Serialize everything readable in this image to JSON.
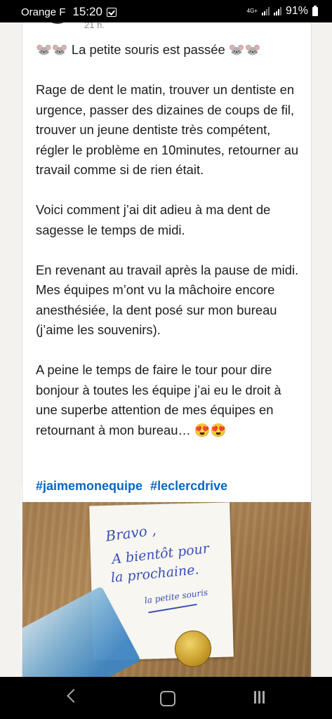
{
  "status_bar": {
    "carrier": "Orange F",
    "time": "15:20",
    "network": "4G+",
    "battery": "91%"
  },
  "post": {
    "time_ago": "21 h.",
    "paragraphs": [
      "🐭🐭  La petite souris est passée 🐭🐭",
      "Rage de dent le matin, trouver un dentiste en urgence, passer des dizaines de coups de fil, trouver un jeune dentiste très compétent, régler le problème en 10minutes, retourner au travail comme si de rien était.",
      "Voici comment j’ai dit adieu à ma dent de sagesse le temps de midi.",
      "En revenant au travail après la pause de midi. Mes équipes m’ont vu la mâchoire encore anesthésiée, la dent posé sur mon bureau (j’aime les souvenirs).",
      "A peine le temps de faire le tour pour dire bonjour à toutes les équipe j’ai eu le droit à une superbe attention de mes équipes en retournant à mon bureau… 😍😍"
    ],
    "hashtags": [
      "#jaimemonequipe",
      "#leclercdrive"
    ],
    "image_note": {
      "line1": "Bravo ,",
      "line2": "A bientôt pour",
      "line3": "la prochaine.",
      "signature": "la petite souris"
    }
  },
  "nav": {
    "back_icon": "back-icon",
    "home_icon": "home-icon",
    "recent_icon": "recent-apps-icon"
  },
  "colors": {
    "hashtag": "#0a66c2",
    "text": "#1d1d1d"
  }
}
